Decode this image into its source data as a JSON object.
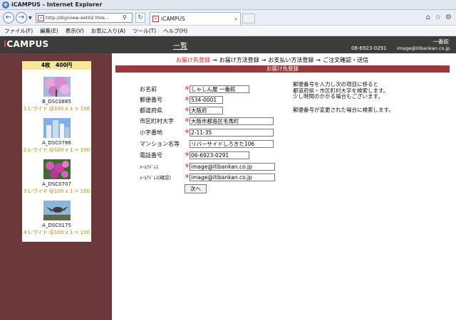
{
  "window": {
    "title": "iCAMPUS - Internet Explorer"
  },
  "browser": {
    "url": "http://digiview-ext02 thre...",
    "tab_title": "iCAMPUS",
    "tab_close": "×"
  },
  "menu": [
    "ファイル(F)",
    "編集(E)",
    "表示(V)",
    "お気に入り(A)",
    "ツール(T)",
    "ヘルプ(H)"
  ],
  "header": {
    "logo_initial": "i",
    "logo_rest": "CAMPUS",
    "list_link": "一覧",
    "store_name": "一番館",
    "phone": "06-6923-0291",
    "email": "image@itibankan.co.jp"
  },
  "cart": {
    "summary": "4枚　400円",
    "items": [
      {
        "name": "B_DSC0885",
        "desc": "1 L-ワイド @100 x 1 = 100",
        "thumb": "cherry-blossom"
      },
      {
        "name": "A_DSC0786",
        "desc": "2 L-ワイド @100 x 1 = 100",
        "thumb": "buildings"
      },
      {
        "name": "A_DSC0707",
        "desc": "3 L-ワイド @100 x 1 = 100",
        "thumb": "flowers"
      },
      {
        "name": "A_DSC0175",
        "desc": "4 L-ワイド @100 x 1 = 100",
        "thumb": "bird"
      }
    ]
  },
  "steps": {
    "s1": "お届け先登録",
    "arrow": "→",
    "s2": "お届け方法登録",
    "s3": "お支払い方法登録",
    "s4": "ご注文確認・送信"
  },
  "section_title": "お届け先登録",
  "form": {
    "required_mark": "＊",
    "fields": [
      {
        "label": "お名前",
        "value": "しゃしん屋 一番館",
        "required": true
      },
      {
        "label": "郵便番号",
        "value": "534-0001",
        "required": true
      },
      {
        "label": "都道府県",
        "value": "大阪府",
        "required": true
      },
      {
        "label": "市区町村大字",
        "value": "大阪市都島区毛馬町",
        "required": true
      },
      {
        "label": "小字番地",
        "value": "2-11-35",
        "required": true
      },
      {
        "label": "マンション名等",
        "value": "リバーサイドしろきた106",
        "required": false
      },
      {
        "label": "電話番号",
        "value": "06-6923-0291",
        "required": true
      },
      {
        "label": "ﾒｰﾙｱﾄﾞﾚｽ",
        "value": "image@itibankan.co.jp",
        "required": true
      },
      {
        "label": "ﾒｰﾙｱﾄﾞﾚｽ(確認)",
        "value": "image@itibankan.co.jp",
        "required": true
      }
    ],
    "next_label": "次へ"
  },
  "notes": {
    "line1": "郵便番号を入力し次の項目に移ると",
    "line2": "都道府県・市区町村大字を検索します。",
    "line3": "少し時間のかかる場合もございます。",
    "line4": "郵便番号が変更された場合に検索します。"
  },
  "colors": {
    "sidebar": "#6c393a",
    "section_bar": "#99393b",
    "header": "#3c3c3c",
    "accent_red": "#dd2222"
  }
}
